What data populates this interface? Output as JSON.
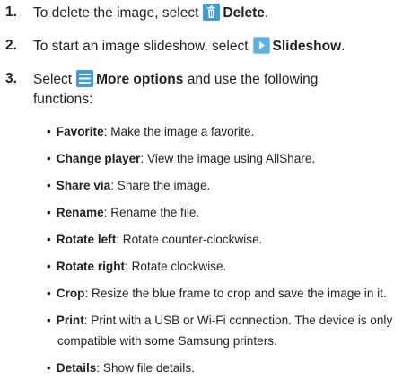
{
  "steps": [
    {
      "number": "1.",
      "before": "To delete the image, select",
      "icon": "trash-icon",
      "label": "Delete",
      "after": "."
    },
    {
      "number": "2.",
      "before": "To start an image slideshow, select",
      "icon": "play-icon",
      "label": "Slideshow",
      "after": "."
    },
    {
      "number": "3.",
      "before": "Select",
      "icon": "menu-icon",
      "label": "More options",
      "after": " and use the following",
      "continuation": "functions:"
    }
  ],
  "functions": [
    {
      "name": "Favorite",
      "description": ": Make the image a favorite."
    },
    {
      "name": "Change player",
      "description": ": View the image using AllShare."
    },
    {
      "name": "Share via",
      "description": ": Share the image."
    },
    {
      "name": "Rename",
      "description": ": Rename the file."
    },
    {
      "name": "Rotate left",
      "description": ": Rotate counter-clockwise."
    },
    {
      "name": "Rotate right",
      "description": ": Rotate clockwise."
    },
    {
      "name": "Crop",
      "description": ": Resize the blue frame to crop and save the image in it."
    },
    {
      "name": "Print",
      "description": ": Print with a USB or Wi-Fi connection. The device is only",
      "continuation": "compatible with some Samsung printers."
    },
    {
      "name": "Details",
      "description": ": Show file details."
    }
  ],
  "colors": {
    "text": "#231f20",
    "icon_blue": "#3d9ed6"
  }
}
